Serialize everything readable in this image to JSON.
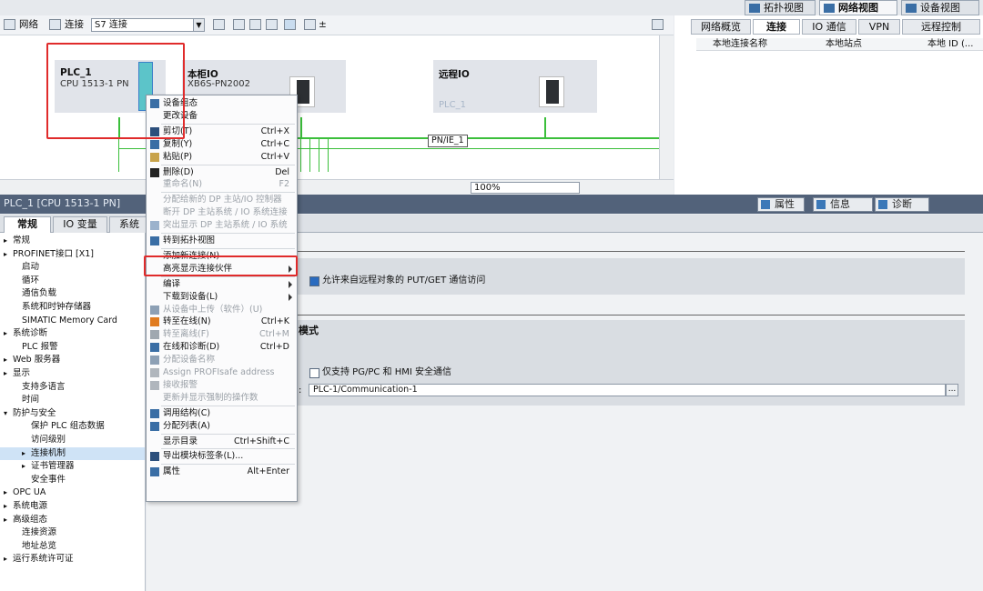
{
  "viewbar": {
    "topology": "拓扑视图",
    "network": "网络视图",
    "device": "设备视图"
  },
  "nettool": {
    "network": "网络",
    "connect": "连接",
    "conn_type": "S7 连接"
  },
  "devices": [
    {
      "name": "PLC_1",
      "type": "CPU 1513-1 PN"
    },
    {
      "name": "本柜IO",
      "type": "XB6S-PN2002"
    },
    {
      "name": "远程IO",
      "type": "PLC_1"
    }
  ],
  "pn_label": "PN/IE_1",
  "zoom": "100%",
  "right_tabs": [
    "网络概览",
    "连接",
    "IO 通信",
    "VPN",
    "远程控制"
  ],
  "right_cols": [
    "本地连接名称",
    "本地站点",
    "本地 ID (..."
  ],
  "props": {
    "title": "PLC_1 [CPU 1513-1 PN]",
    "tabs": [
      "属性",
      "信息",
      "诊断"
    ]
  },
  "subtabs": [
    "常规",
    "IO 变量",
    "系统"
  ],
  "tree": [
    {
      "label": "常规",
      "indent": 0,
      "arrow": "▸"
    },
    {
      "label": "PROFINET接口 [X1]",
      "indent": 0,
      "arrow": "▸"
    },
    {
      "label": "启动",
      "indent": 1,
      "arrow": ""
    },
    {
      "label": "循环",
      "indent": 1,
      "arrow": ""
    },
    {
      "label": "通信负载",
      "indent": 1,
      "arrow": ""
    },
    {
      "label": "系统和时钟存储器",
      "indent": 1,
      "arrow": ""
    },
    {
      "label": "SIMATIC Memory Card",
      "indent": 1,
      "arrow": ""
    },
    {
      "label": "系统诊断",
      "indent": 0,
      "arrow": "▸"
    },
    {
      "label": "PLC 报警",
      "indent": 1,
      "arrow": ""
    },
    {
      "label": "Web 服务器",
      "indent": 0,
      "arrow": "▸"
    },
    {
      "label": "显示",
      "indent": 0,
      "arrow": "▸"
    },
    {
      "label": "支持多语言",
      "indent": 1,
      "arrow": ""
    },
    {
      "label": "时间",
      "indent": 1,
      "arrow": ""
    },
    {
      "label": "防护与安全",
      "indent": 0,
      "arrow": "▾"
    },
    {
      "label": "保护 PLC 组态数据",
      "indent": 2,
      "arrow": ""
    },
    {
      "label": "访问级别",
      "indent": 2,
      "arrow": ""
    },
    {
      "label": "连接机制",
      "indent": 2,
      "arrow": "▸",
      "selected": true
    },
    {
      "label": "证书管理器",
      "indent": 2,
      "arrow": "▸"
    },
    {
      "label": "安全事件",
      "indent": 2,
      "arrow": ""
    },
    {
      "label": "OPC UA",
      "indent": 0,
      "arrow": "▸"
    },
    {
      "label": "系统电源",
      "indent": 0,
      "arrow": "▸"
    },
    {
      "label": "高级组态",
      "indent": 0,
      "arrow": "▸"
    },
    {
      "label": "连接资源",
      "indent": 1,
      "arrow": ""
    },
    {
      "label": "地址总览",
      "indent": 1,
      "arrow": ""
    },
    {
      "label": "运行系统许可证",
      "indent": 0,
      "arrow": "▸"
    }
  ],
  "content": {
    "putget": "允许来自远程对象的 PUT/GET 通信访问",
    "mode_title": "模式",
    "pgpc": "仅支持 PG/PC 和 HMI 安全通信",
    "field_value": "PLC-1/Communication-1",
    "field_btn": "..."
  },
  "menu": [
    {
      "label": "设备组态",
      "shortcut": "",
      "icon": "cfg",
      "disabled": false
    },
    {
      "label": "更改设备",
      "shortcut": "",
      "icon": "",
      "disabled": false
    },
    {
      "sep": true
    },
    {
      "label": "剪切(T)",
      "shortcut": "Ctrl+X",
      "icon": "cut",
      "disabled": false
    },
    {
      "label": "复制(Y)",
      "shortcut": "Ctrl+C",
      "icon": "copy",
      "disabled": false
    },
    {
      "label": "粘贴(P)",
      "shortcut": "Ctrl+V",
      "icon": "paste",
      "disabled": false
    },
    {
      "sep": true
    },
    {
      "label": "删除(D)",
      "shortcut": "Del",
      "icon": "del",
      "disabled": false
    },
    {
      "label": "重命名(N)",
      "shortcut": "F2",
      "icon": "",
      "disabled": true
    },
    {
      "sep": true
    },
    {
      "label": "分配给新的 DP 主站/IO 控制器",
      "shortcut": "",
      "icon": "",
      "disabled": true
    },
    {
      "label": "断开 DP 主站系统 / IO 系统连接",
      "shortcut": "",
      "icon": "",
      "disabled": true
    },
    {
      "label": "突出显示 DP 主站系统 / IO 系统",
      "shortcut": "",
      "icon": "hl",
      "disabled": true
    },
    {
      "sep": true
    },
    {
      "label": "转到拓扑视图",
      "shortcut": "",
      "icon": "topo",
      "disabled": false
    },
    {
      "sep": true
    },
    {
      "label": "添加新连接(N)",
      "shortcut": "",
      "icon": "",
      "disabled": false
    },
    {
      "label": "高亮显示连接伙伴",
      "shortcut": "",
      "icon": "",
      "disabled": false,
      "sub": true
    },
    {
      "sep": true
    },
    {
      "label": "编译",
      "shortcut": "",
      "icon": "",
      "disabled": false,
      "sub": true
    },
    {
      "label": "下载到设备(L)",
      "shortcut": "",
      "icon": "",
      "disabled": false,
      "sub": true
    },
    {
      "label": "从设备中上传（软件）(U)",
      "shortcut": "",
      "icon": "up",
      "disabled": true
    },
    {
      "label": "转至在线(N)",
      "shortcut": "Ctrl+K",
      "icon": "online",
      "disabled": false
    },
    {
      "label": "转至离线(F)",
      "shortcut": "Ctrl+M",
      "icon": "offline",
      "disabled": true
    },
    {
      "label": "在线和诊断(D)",
      "shortcut": "Ctrl+D",
      "icon": "diag",
      "disabled": false
    },
    {
      "label": "分配设备名称",
      "shortcut": "",
      "icon": "name",
      "disabled": true
    },
    {
      "label": "Assign PROFIsafe address",
      "shortcut": "",
      "icon": "safe",
      "disabled": true
    },
    {
      "label": "接收报警",
      "shortcut": "",
      "icon": "alarm",
      "disabled": true
    },
    {
      "label": "更新并显示强制的操作数",
      "shortcut": "",
      "icon": "",
      "disabled": true
    },
    {
      "sep": true
    },
    {
      "label": "调用结构(C)",
      "shortcut": "",
      "icon": "struct",
      "disabled": false
    },
    {
      "label": "分配列表(A)",
      "shortcut": "",
      "icon": "list",
      "disabled": false
    },
    {
      "sep": true
    },
    {
      "label": "显示目录",
      "shortcut": "Ctrl+Shift+C",
      "icon": "",
      "disabled": false
    },
    {
      "sep": true
    },
    {
      "label": "导出模块标签条(L)...",
      "shortcut": "",
      "icon": "export",
      "disabled": false
    },
    {
      "sep": true
    },
    {
      "label": "属性",
      "shortcut": "Alt+Enter",
      "icon": "prop",
      "disabled": false
    }
  ],
  "colors": {
    "accent": "#3bbf3b",
    "highlight": "#e02b2b",
    "header": "#52627a"
  }
}
